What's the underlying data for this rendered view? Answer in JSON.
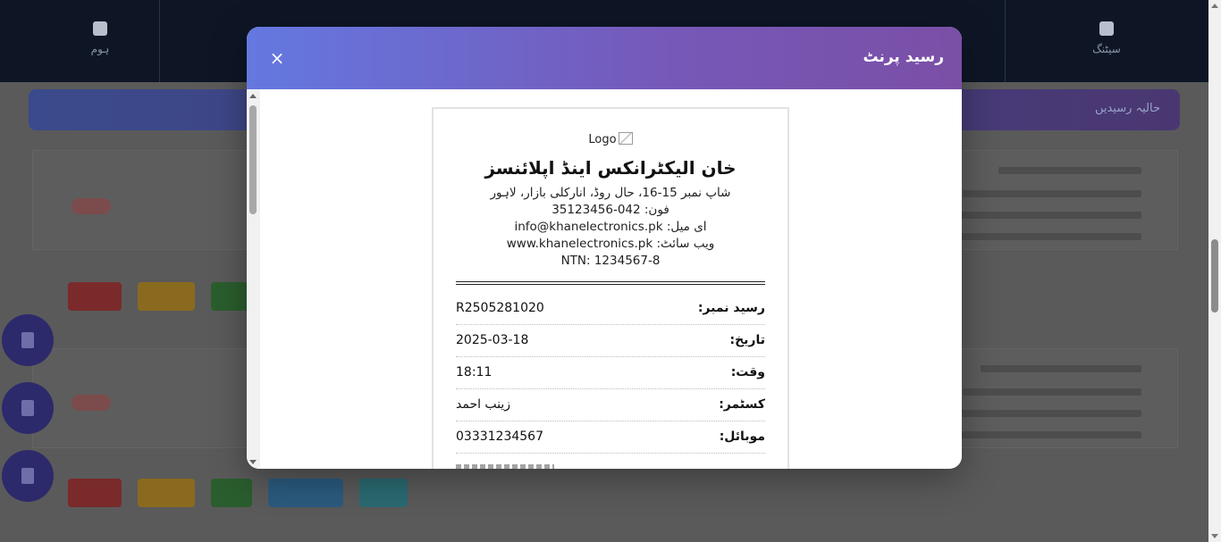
{
  "background": {
    "nav_items": [
      "ہوم",
      "",
      "",
      "",
      "",
      "",
      "سیٹنگ"
    ],
    "page_title": "حالیہ رسیدیں"
  },
  "modal": {
    "title": "رسید پرنٹ",
    "close_label": "×"
  },
  "receipt": {
    "logo_alt": "Logo",
    "shop_name": "خان الیکٹرانکس اینڈ اپلائنسز",
    "address": "شاپ نمبر 15-16، حال روڈ، انارکلی بازار، لاہور",
    "phone": "فون: 042-35123456",
    "email": "ای میل: info@khanelectronics.pk",
    "website": "ویب سائٹ: www.khanelectronics.pk",
    "ntn": "NTN: 1234567-8",
    "fields": [
      {
        "label": "رسید نمبر:",
        "value": "R2505281020"
      },
      {
        "label": "تاریخ:",
        "value": "2025-03-18"
      },
      {
        "label": "وقت:",
        "value": "18:11"
      },
      {
        "label": "کسٹمر:",
        "value": "زینب احمد"
      },
      {
        "label": "موبائل:",
        "value": "03331234567"
      }
    ]
  },
  "colors": {
    "header_start": "#6478e0",
    "header_end": "#7a4fa6",
    "nav_bg": "#0e1626"
  },
  "icons": [
    "close-icon",
    "broken-image-icon",
    "home-icon",
    "settings-icon",
    "print-icon"
  ]
}
